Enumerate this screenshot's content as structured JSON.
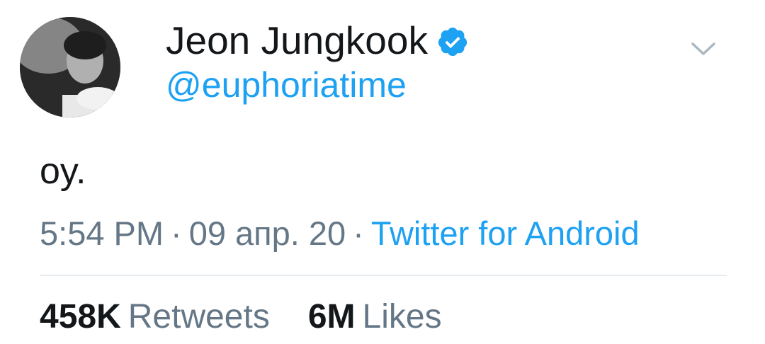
{
  "tweet": {
    "author": {
      "display_name": "Jeon Jungkook",
      "handle": "@euphoriatime",
      "verified": true,
      "avatar_icon": "user-avatar"
    },
    "menu_icon": "chevron-down-icon",
    "text": "oy.",
    "meta": {
      "time": "5:54 PM",
      "separator": "·",
      "date": "09 апр. 20",
      "source": "Twitter for Android"
    },
    "stats": {
      "retweets_count": "458K",
      "retweets_label": "Retweets",
      "likes_count": "6M",
      "likes_label": "Likes"
    }
  },
  "colors": {
    "text_primary": "#14171a",
    "text_secondary": "#657786",
    "accent_blue": "#1da1f2",
    "divider": "#e6ecf0"
  }
}
